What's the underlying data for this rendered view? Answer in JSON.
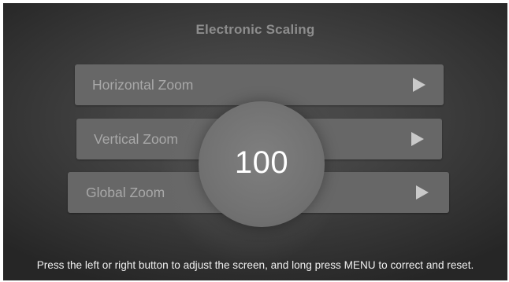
{
  "screen": {
    "title": "Electronic Scaling",
    "hint": "Press the left or right button to adjust the screen, and long press MENU to correct and reset."
  },
  "menu": {
    "items": [
      {
        "label": "Horizontal Zoom",
        "arrow_icon": "play-right-arrow-icon"
      },
      {
        "label": "Vertical Zoom",
        "arrow_icon": "play-right-arrow-icon"
      },
      {
        "label": "Global Zoom",
        "arrow_icon": "play-right-arrow-icon"
      }
    ]
  },
  "zoom_indicator": {
    "value": "100"
  },
  "colors": {
    "background": "#3a3a3a",
    "row": "#676767",
    "row_text": "#a8a8a8",
    "value_text": "#ffffff",
    "hint_text": "#f0f0f0"
  }
}
